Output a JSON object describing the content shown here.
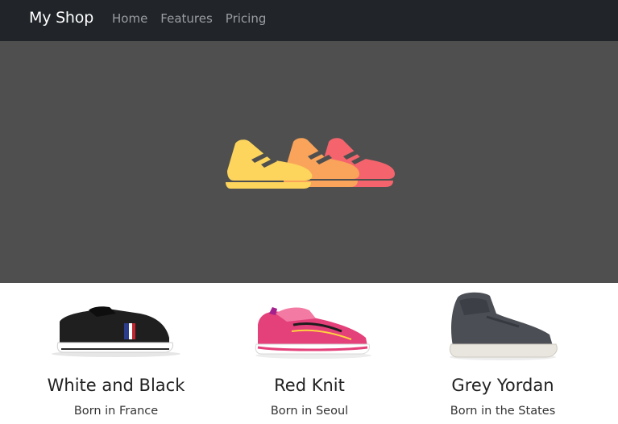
{
  "navbar": {
    "brand": "My Shop",
    "links": [
      "Home",
      "Features",
      "Pricing"
    ]
  },
  "hero": {
    "logo_icon": "shoes-logo-icon",
    "logo_colors": [
      "#fdd45c",
      "#f9a45a",
      "#f5646c"
    ],
    "background": "#4f4f4f"
  },
  "products": [
    {
      "title": "White and Black",
      "subtitle": "Born in France",
      "icon": "black-sneaker-icon"
    },
    {
      "title": "Red Knit",
      "subtitle": "Born in Seoul",
      "icon": "pink-running-shoe-icon"
    },
    {
      "title": "Grey Yordan",
      "subtitle": "Born in the States",
      "icon": "grey-high-top-icon"
    }
  ]
}
